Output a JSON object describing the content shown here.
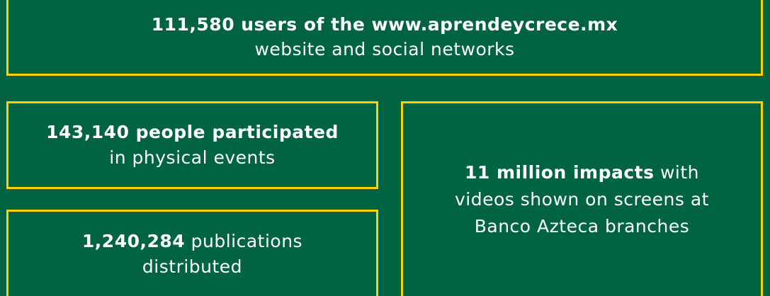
{
  "stats": {
    "web_users": {
      "line1_bold": "111,580 users of the www.aprendeycrece.mx",
      "line2": "website and social networks"
    },
    "event_participants": {
      "line1_bold": "143,140 people participated",
      "line2": "in physical events"
    },
    "publications": {
      "line1_bold": "1,240,284",
      "line1_rest": " publications",
      "line2": "distributed"
    },
    "video_impacts": {
      "line1_bold": "11 million impacts",
      "line1_rest": " with",
      "line2": "videos shown on screens at",
      "line3": "Banco Azteca branches"
    }
  },
  "colors": {
    "background": "#006341",
    "border": "#ffd100",
    "text": "#ffffff"
  }
}
